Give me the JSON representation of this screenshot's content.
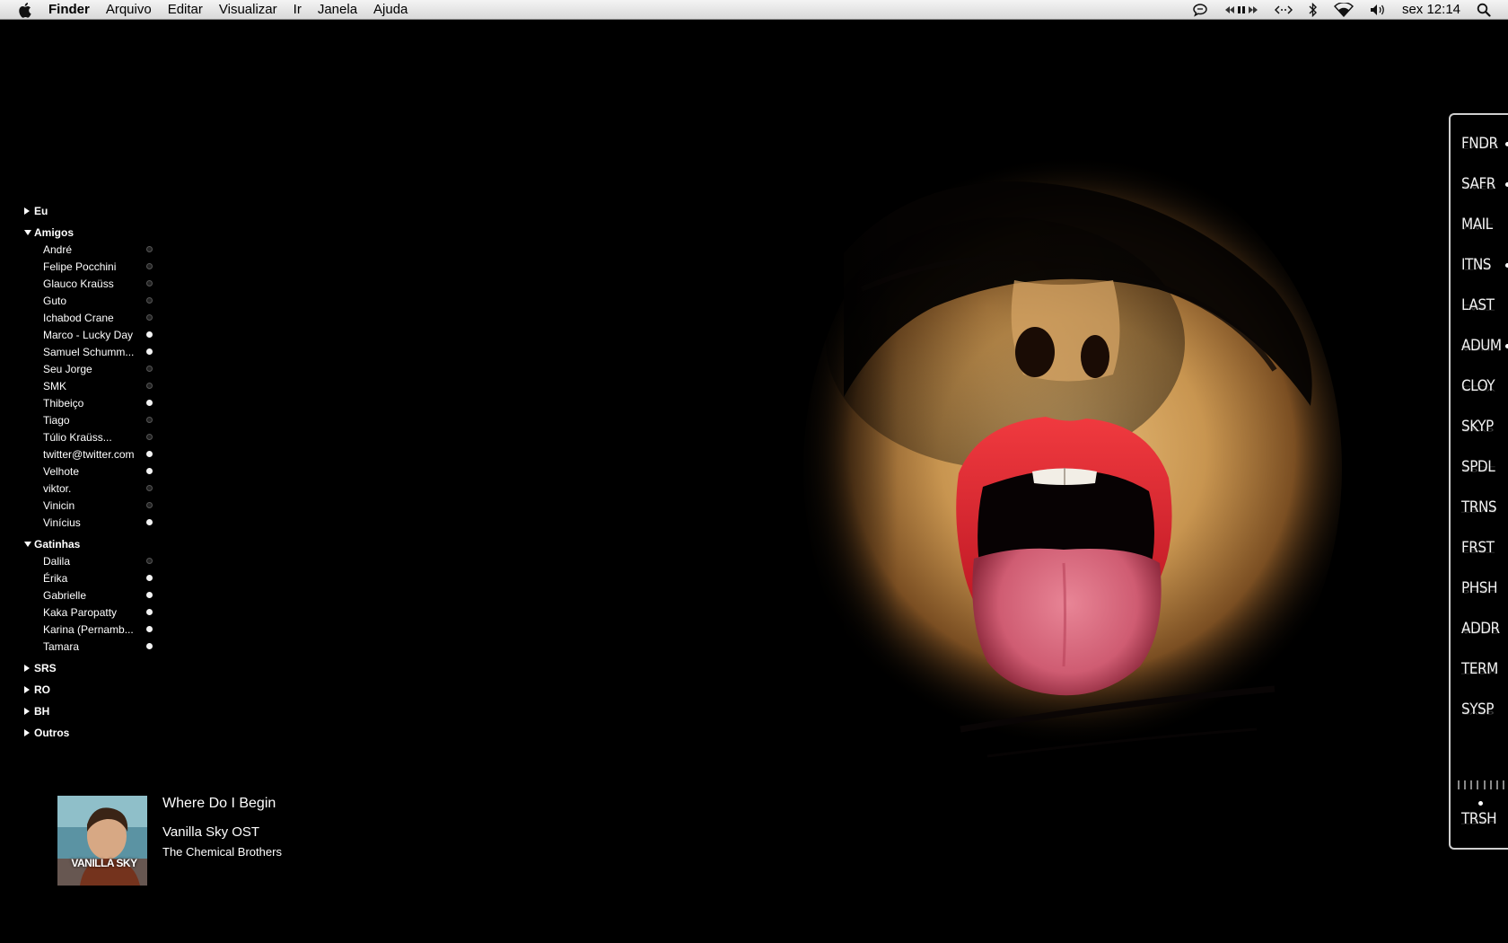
{
  "menubar": {
    "apple_icon": "apple-logo-icon",
    "app_name": "Finder",
    "menus": [
      "Arquivo",
      "Editar",
      "Visualizar",
      "Ir",
      "Janela",
      "Ajuda"
    ],
    "status_icons": [
      "chat-bubble-icon",
      "media-controls-icon",
      "screen-sharing-icon",
      "bluetooth-icon",
      "wifi-icon",
      "volume-icon"
    ],
    "clock": "sex 12:14",
    "spotlight_icon": "spotlight-search-icon"
  },
  "buddy_list": {
    "groups": [
      {
        "name": "Eu",
        "expanded": false,
        "buddies": []
      },
      {
        "name": "Amigos",
        "expanded": true,
        "buddies": [
          {
            "name": "André",
            "status": "idle"
          },
          {
            "name": "Felipe Pocchini",
            "status": "idle"
          },
          {
            "name": "Glauco Kraüss",
            "status": "idle"
          },
          {
            "name": "Guto",
            "status": "idle"
          },
          {
            "name": "Ichabod Crane",
            "status": "idle"
          },
          {
            "name": "Marco - Lucky Day",
            "status": "online"
          },
          {
            "name": "Samuel Schumm...",
            "status": "online"
          },
          {
            "name": "Seu Jorge",
            "status": "idle"
          },
          {
            "name": "SMK",
            "status": "idle"
          },
          {
            "name": "Thibeiço",
            "status": "online"
          },
          {
            "name": "Tiago",
            "status": "idle"
          },
          {
            "name": "Túlio Kraüss...",
            "status": "idle"
          },
          {
            "name": "twitter@twitter.com",
            "status": "online"
          },
          {
            "name": "Velhote",
            "status": "online"
          },
          {
            "name": "viktor.",
            "status": "idle"
          },
          {
            "name": "Vinicin",
            "status": "idle"
          },
          {
            "name": "Vinícius",
            "status": "online"
          }
        ]
      },
      {
        "name": "Gatinhas",
        "expanded": true,
        "buddies": [
          {
            "name": "Dalila",
            "status": "idle"
          },
          {
            "name": "Érika",
            "status": "online"
          },
          {
            "name": "Gabrielle",
            "status": "online"
          },
          {
            "name": "Kaka Paropatty",
            "status": "online"
          },
          {
            "name": "Karina (Pernamb...",
            "status": "online"
          },
          {
            "name": "Tamara",
            "status": "online"
          }
        ]
      },
      {
        "name": "SRS",
        "expanded": false,
        "buddies": []
      },
      {
        "name": "RO",
        "expanded": false,
        "buddies": []
      },
      {
        "name": "BH",
        "expanded": false,
        "buddies": []
      },
      {
        "name": "Outros",
        "expanded": false,
        "buddies": []
      }
    ]
  },
  "now_playing": {
    "title": "Where Do I Begin",
    "album": "Vanilla Sky OST",
    "artist": "The Chemical Brothers",
    "cover_text": "VANILLA SKY"
  },
  "dock": {
    "items": [
      {
        "label": "FNDR",
        "running": true
      },
      {
        "label": "SAFR",
        "running": true
      },
      {
        "label": "MAIL",
        "running": false
      },
      {
        "label": "ITNS",
        "running": true
      },
      {
        "label": "LAST",
        "running": false
      },
      {
        "label": "ADUM",
        "running": true
      },
      {
        "label": "CLOY",
        "running": false
      },
      {
        "label": "SKYP",
        "running": false
      },
      {
        "label": "SPDL",
        "running": false
      },
      {
        "label": "TRNS",
        "running": false
      },
      {
        "label": "FRST",
        "running": false
      },
      {
        "label": "PHSH",
        "running": false
      },
      {
        "label": "ADDR",
        "running": false
      },
      {
        "label": "TERM",
        "running": false
      },
      {
        "label": "SYSP",
        "running": false
      }
    ],
    "trash_label": "TRSH"
  },
  "colors": {
    "desktop_bg": "#000000",
    "lips": "#d8192a",
    "tongue": "#d96a80",
    "skin": "#d9a865"
  }
}
